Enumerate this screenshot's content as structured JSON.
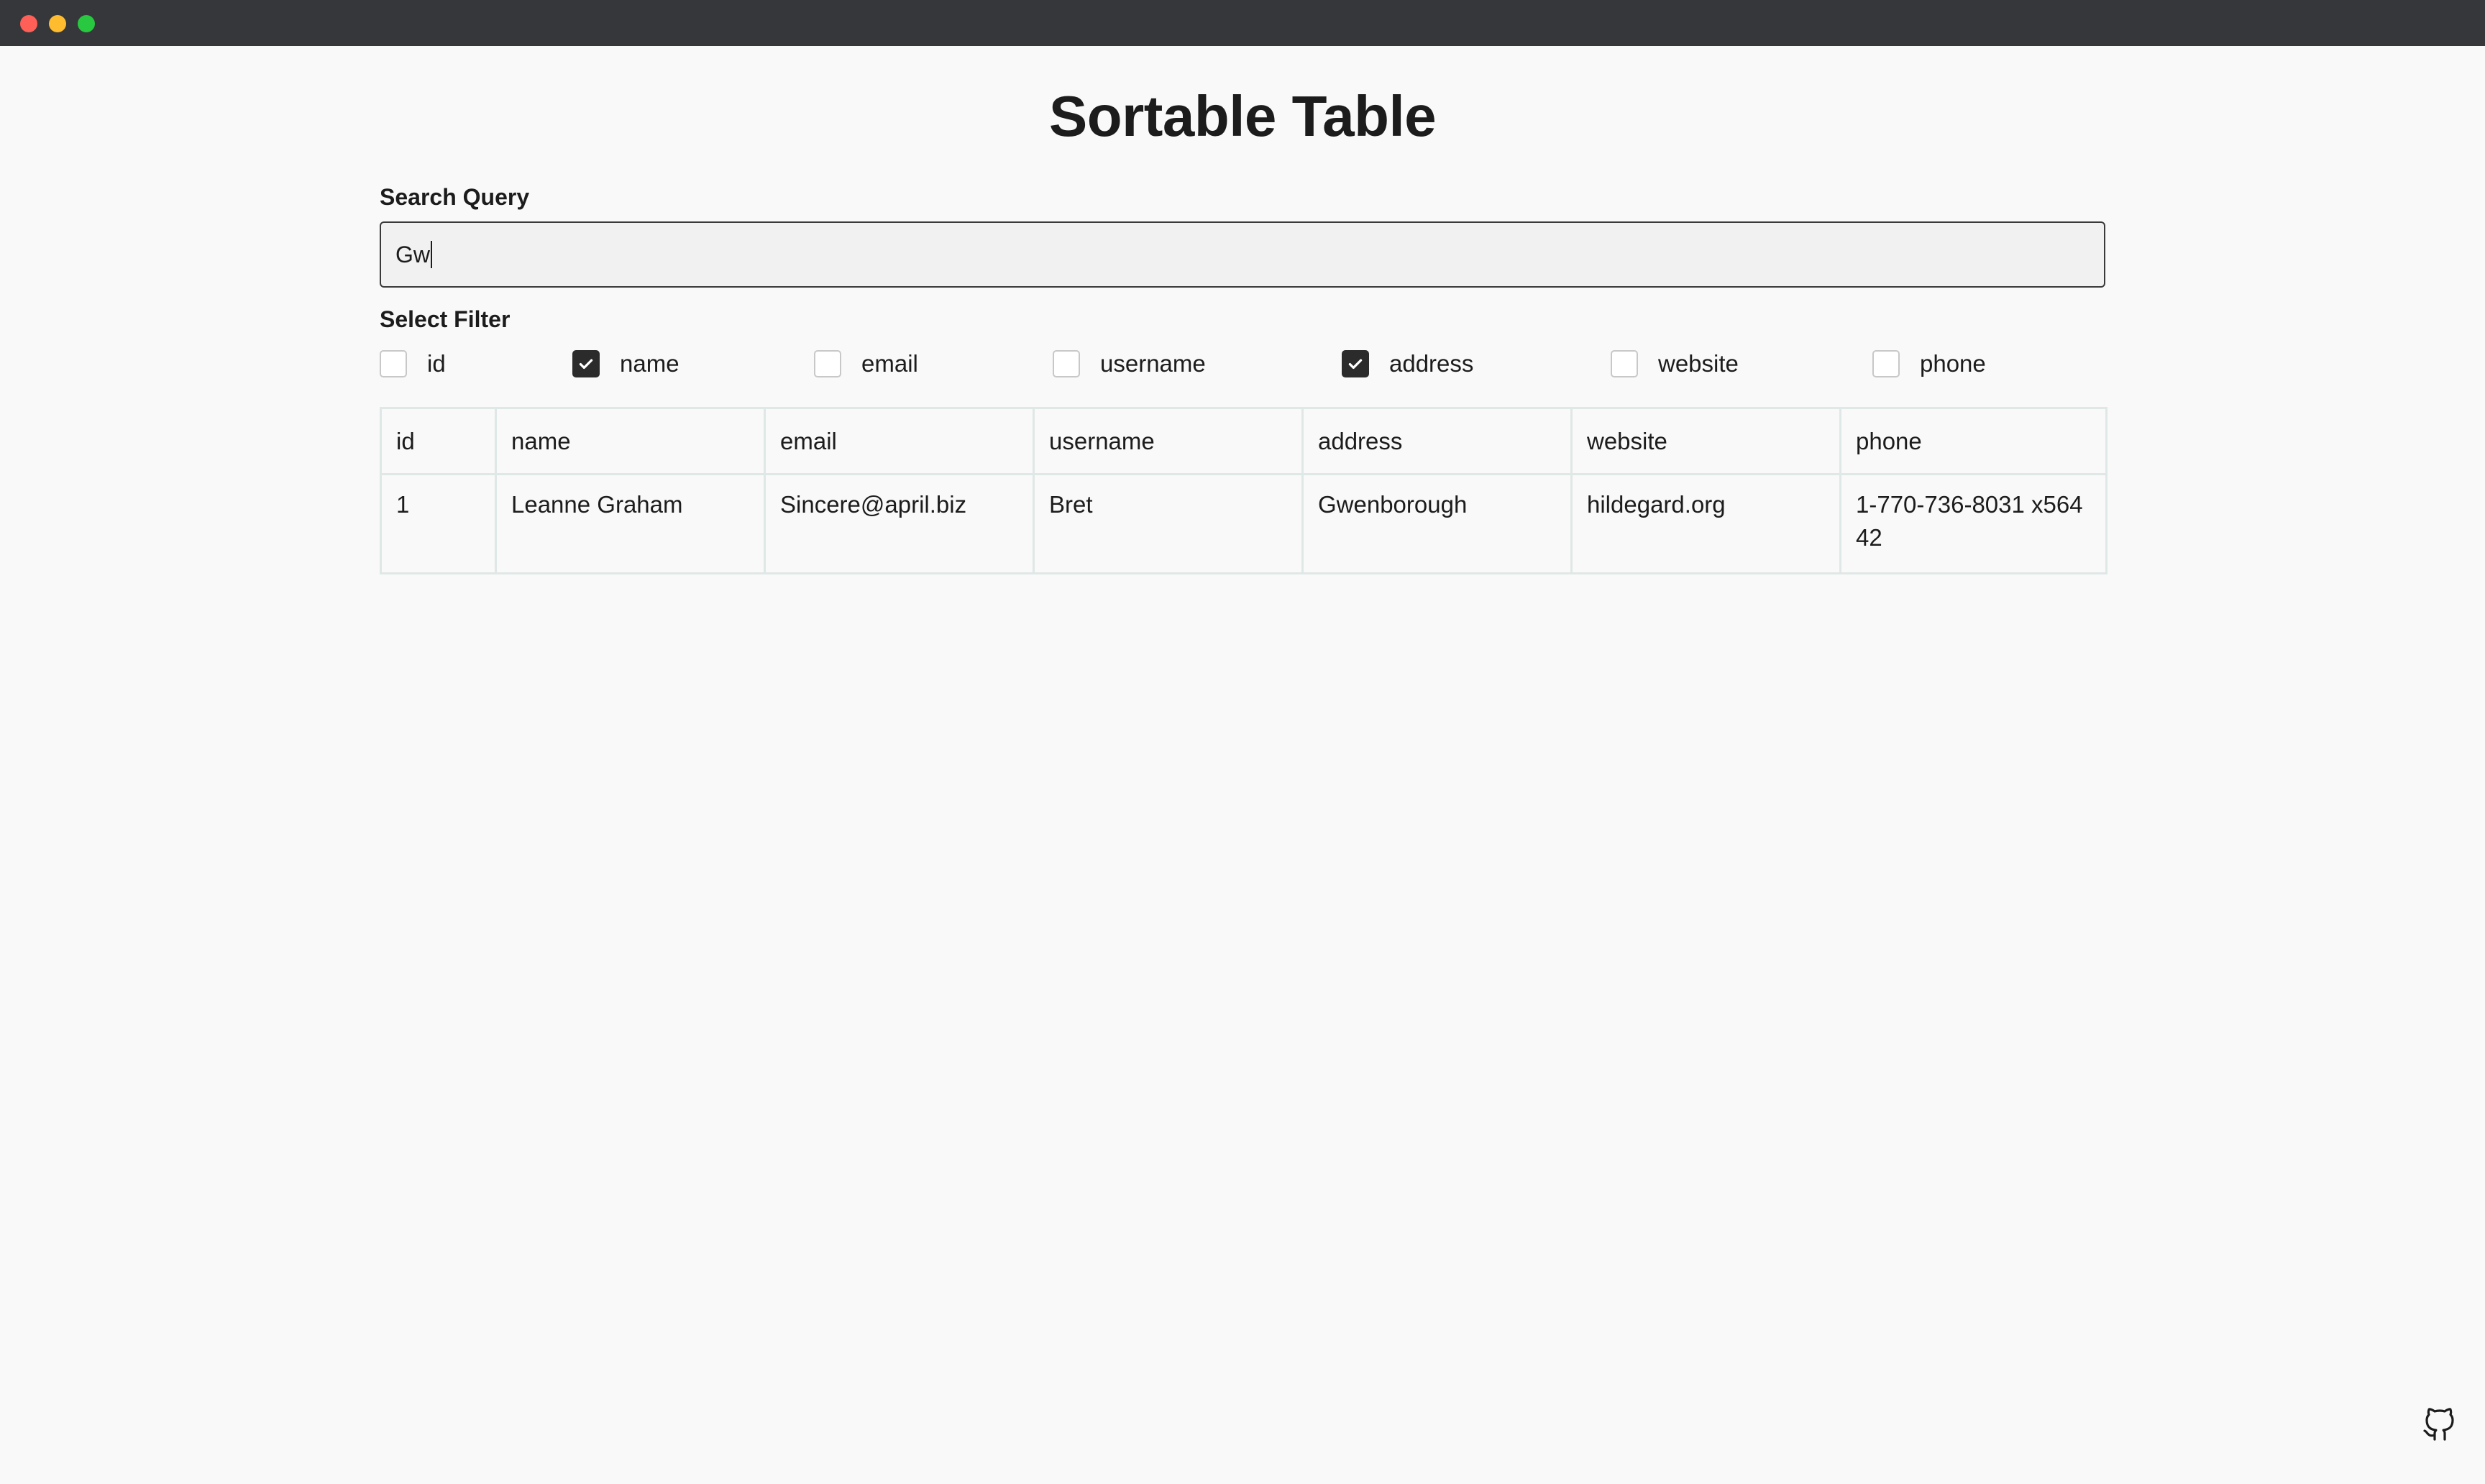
{
  "page": {
    "title": "Sortable Table"
  },
  "search": {
    "label": "Search Query",
    "value": "Gw"
  },
  "filter": {
    "label": "Select Filter",
    "options": [
      {
        "label": "id",
        "checked": false
      },
      {
        "label": "name",
        "checked": true
      },
      {
        "label": "email",
        "checked": false
      },
      {
        "label": "username",
        "checked": false
      },
      {
        "label": "address",
        "checked": true
      },
      {
        "label": "website",
        "checked": false
      },
      {
        "label": "phone",
        "checked": false
      }
    ]
  },
  "table": {
    "headers": [
      "id",
      "name",
      "email",
      "username",
      "address",
      "website",
      "phone"
    ],
    "rows": [
      [
        "1",
        "Leanne Graham",
        "Sincere@april.biz",
        "Bret",
        "Gwenborough",
        "hildegard.org",
        "1-770-736-8031 x56442"
      ]
    ]
  },
  "footer": {
    "icon": "github-icon"
  },
  "colors": {
    "titlebar": "#36373a",
    "checked": "#2b2b2b",
    "table_border": "#dfe8e6"
  }
}
